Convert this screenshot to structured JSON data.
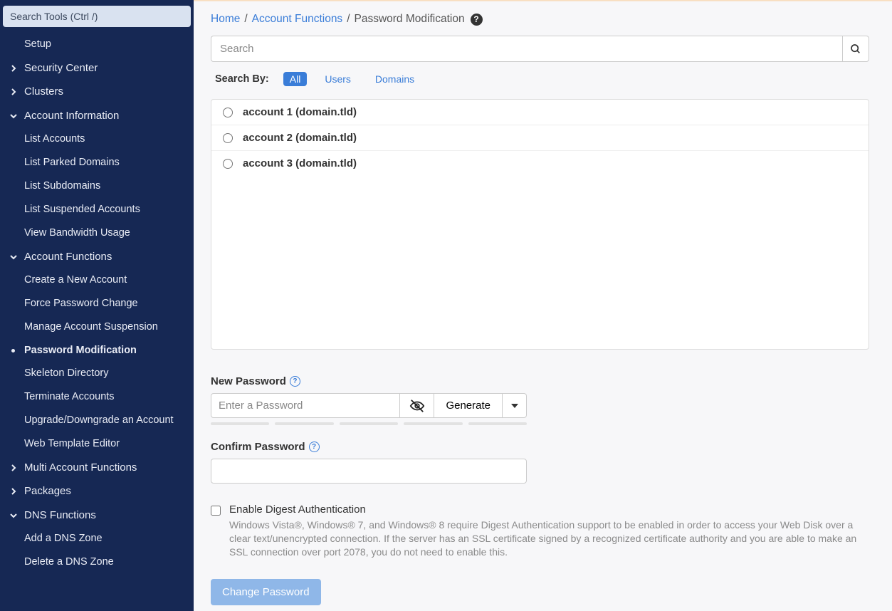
{
  "sidebar": {
    "search_placeholder": "Search Tools (Ctrl /)",
    "items": [
      {
        "label": "Setup",
        "type": "leaf"
      },
      {
        "label": "Security Center",
        "type": "section",
        "expanded": false
      },
      {
        "label": "Clusters",
        "type": "section",
        "expanded": false
      },
      {
        "label": "Account Information",
        "type": "section",
        "expanded": true
      },
      {
        "label": "List Accounts",
        "type": "leaf"
      },
      {
        "label": "List Parked Domains",
        "type": "leaf"
      },
      {
        "label": "List Subdomains",
        "type": "leaf"
      },
      {
        "label": "List Suspended Accounts",
        "type": "leaf"
      },
      {
        "label": "View Bandwidth Usage",
        "type": "leaf"
      },
      {
        "label": "Account Functions",
        "type": "section",
        "expanded": true
      },
      {
        "label": "Create a New Account",
        "type": "leaf"
      },
      {
        "label": "Force Password Change",
        "type": "leaf"
      },
      {
        "label": "Manage Account Suspension",
        "type": "leaf"
      },
      {
        "label": "Password Modification",
        "type": "leaf",
        "active": true
      },
      {
        "label": "Skeleton Directory",
        "type": "leaf"
      },
      {
        "label": "Terminate Accounts",
        "type": "leaf"
      },
      {
        "label": "Upgrade/Downgrade an Account",
        "type": "leaf"
      },
      {
        "label": "Web Template Editor",
        "type": "leaf"
      },
      {
        "label": "Multi Account Functions",
        "type": "section",
        "expanded": false
      },
      {
        "label": "Packages",
        "type": "section",
        "expanded": false
      },
      {
        "label": "DNS Functions",
        "type": "section",
        "expanded": true
      },
      {
        "label": "Add a DNS Zone",
        "type": "leaf"
      },
      {
        "label": "Delete a DNS Zone",
        "type": "leaf"
      }
    ]
  },
  "breadcrumb": {
    "home": "Home",
    "section": "Account Functions",
    "current": "Password Modification"
  },
  "search": {
    "placeholder": "Search",
    "by_label": "Search By:",
    "filters": {
      "all": "All",
      "users": "Users",
      "domains": "Domains"
    }
  },
  "accounts": [
    {
      "label": "account 1 (domain.tld)"
    },
    {
      "label": "account 2 (domain.tld)"
    },
    {
      "label": "account 3 (domain.tld)"
    }
  ],
  "password": {
    "new_label": "New Password",
    "placeholder": "Enter a Password",
    "generate": "Generate",
    "confirm_label": "Confirm Password"
  },
  "digest": {
    "title": "Enable Digest Authentication",
    "desc": "Windows Vista®, Windows® 7, and Windows® 8 require Digest Authentication support to be enabled in order to access your Web Disk over a clear text/unencrypted connection. If the server has an SSL certificate signed by a recognized certificate authority and you are able to make an SSL connection over port 2078, you do not need to enable this."
  },
  "submit_label": "Change Password"
}
